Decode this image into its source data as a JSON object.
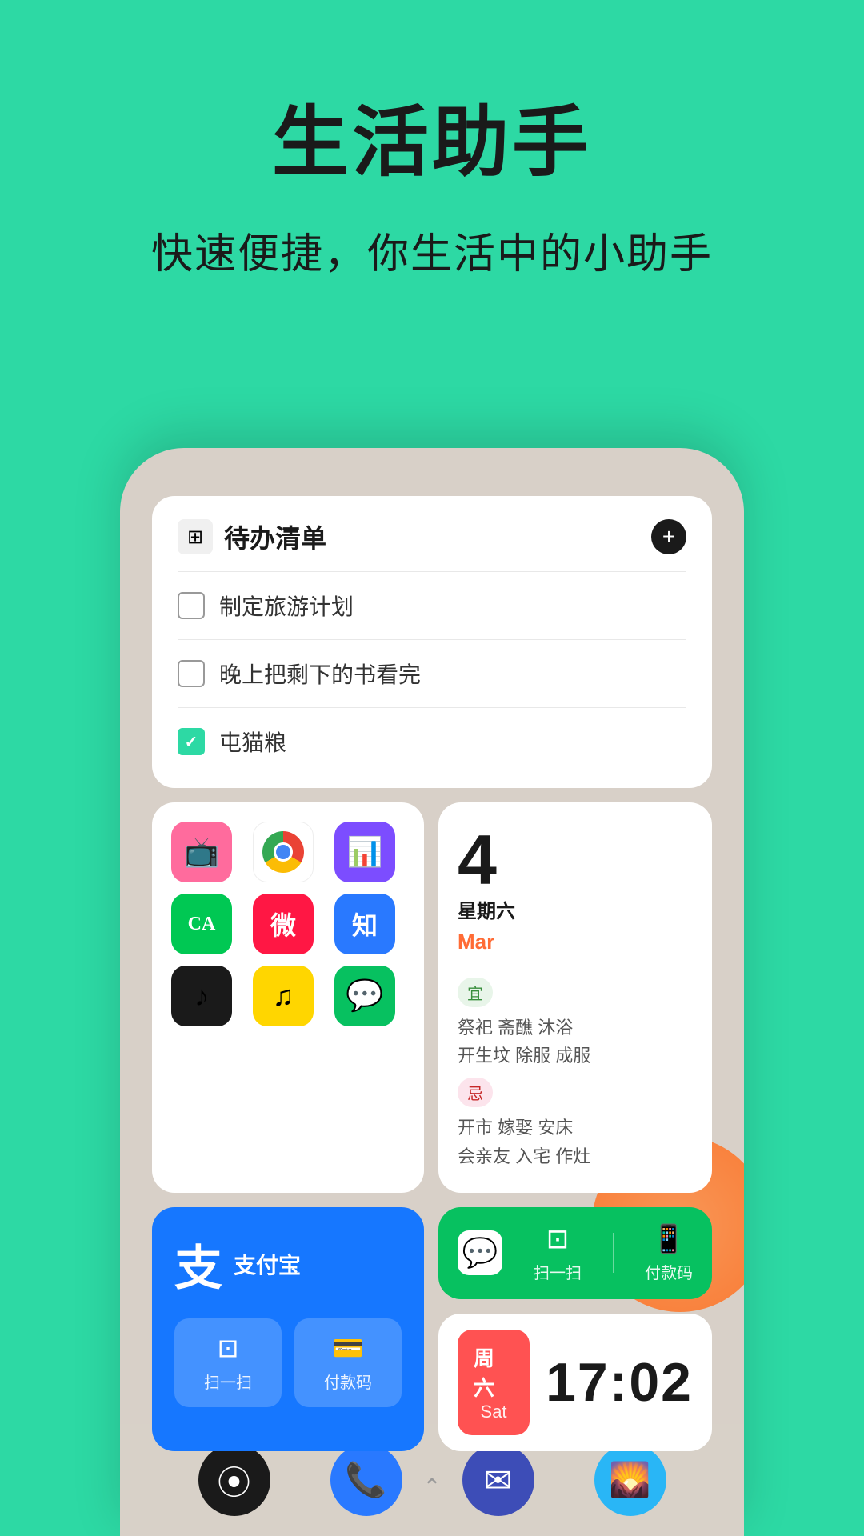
{
  "header": {
    "title": "生活助手",
    "subtitle": "快速便捷，你生活中的小助手"
  },
  "todo_widget": {
    "title": "待办清单",
    "add_label": "+",
    "items": [
      {
        "text": "制定旅游计划",
        "checked": false
      },
      {
        "text": "晚上把剩下的书看完",
        "checked": false
      },
      {
        "text": "屯猫粮",
        "checked": true
      }
    ]
  },
  "app_grid": {
    "apps": [
      {
        "name": "media-app",
        "color": "pink",
        "emoji": "📺"
      },
      {
        "name": "chrome-app",
        "color": "chrome",
        "emoji": "🌐"
      },
      {
        "name": "analytics-app",
        "color": "purple",
        "emoji": "📊"
      },
      {
        "name": "ca-app",
        "color": "green-dark",
        "emoji": "CA"
      },
      {
        "name": "weibo-app",
        "color": "red",
        "emoji": "微"
      },
      {
        "name": "zhihu-app",
        "color": "blue-light",
        "emoji": "知"
      },
      {
        "name": "tiktok-app",
        "color": "black",
        "emoji": "♪"
      },
      {
        "name": "music-app",
        "color": "yellow",
        "emoji": "♫"
      },
      {
        "name": "wechat-app",
        "color": "green-wechat",
        "emoji": "💬"
      }
    ]
  },
  "calendar_widget": {
    "date": "4",
    "weekday": "星期六",
    "month": "Mar",
    "good_label": "宜",
    "good_items": "祭祀 斋醮 沐浴\n开生坟 除服 成服",
    "bad_label": "忌",
    "bad_items": "开市 嫁娶 安床\n会亲友 入宅 作灶"
  },
  "alipay_widget": {
    "name": "支付宝",
    "logo": "支",
    "scan_label": "扫一扫",
    "pay_label": "付款码"
  },
  "wechat_quick": {
    "scan_label": "扫一扫",
    "pay_label": "付款码"
  },
  "clock_widget": {
    "weekday_zh": "周六",
    "weekday_en": "Sat",
    "time": "17:02"
  },
  "dock": {
    "items": [
      {
        "name": "camera",
        "emoji": "📷"
      },
      {
        "name": "phone",
        "emoji": "📞"
      },
      {
        "name": "message",
        "emoji": "💬"
      },
      {
        "name": "gallery",
        "emoji": "🌄"
      }
    ]
  }
}
